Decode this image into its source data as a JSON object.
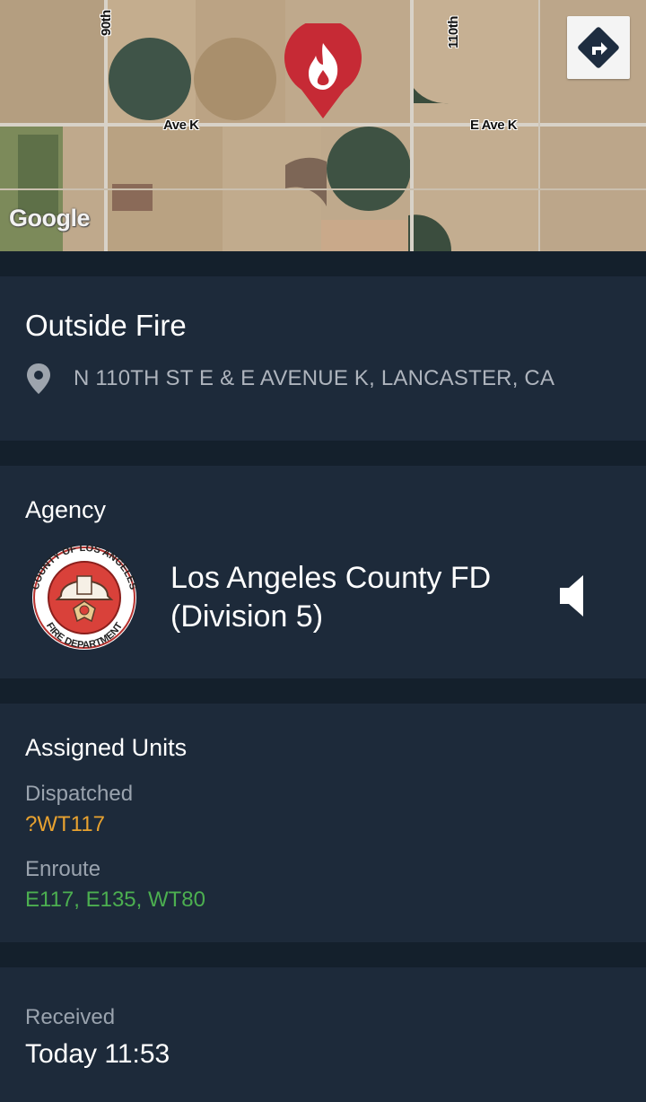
{
  "map": {
    "roads": {
      "street_90th": "90th",
      "street_110th": "110th",
      "ave_k": "Ave K",
      "e_ave_k": "E Ave K"
    },
    "provider_logo": "Google",
    "pin_icon": "fire-icon",
    "pin_color": "#c62a35",
    "directions_icon": "directions-icon"
  },
  "incident": {
    "title": "Outside Fire",
    "location_icon": "location-pin-icon",
    "address": "N 110TH ST E & E AVENUE K, LANCASTER, CA"
  },
  "agency": {
    "section_title": "Agency",
    "seal_text_top": "COUNTY OF LOS ANGELES",
    "seal_text_bottom": "FIRE DEPARTMENT",
    "name": "Los Angeles County FD (Division 5)",
    "audio_icon": "speaker-icon"
  },
  "units": {
    "section_title": "Assigned Units",
    "dispatched_label": "Dispatched",
    "dispatched_units": "?WT117",
    "enroute_label": "Enroute",
    "enroute_units": "E117, E135, WT80",
    "dispatched_color": "#e8a230",
    "enroute_color": "#4caf50"
  },
  "received": {
    "label": "Received",
    "time": "Today 11:53"
  }
}
